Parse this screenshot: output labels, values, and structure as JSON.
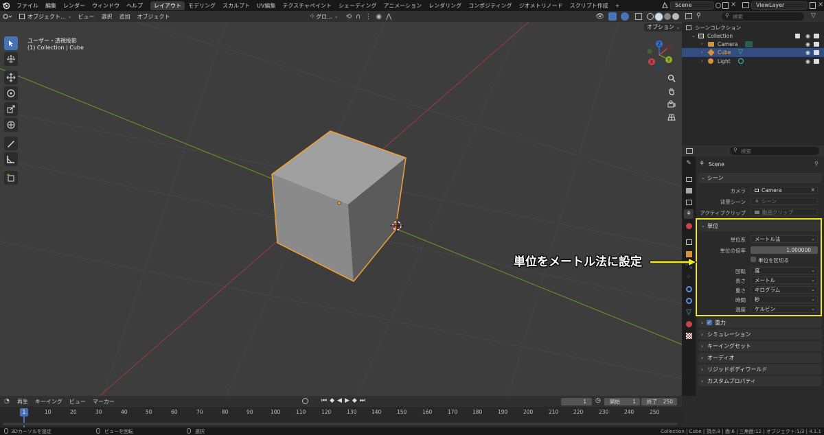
{
  "topbar": {
    "menus": [
      "ファイル",
      "編集",
      "レンダー",
      "ウィンドウ",
      "ヘルプ"
    ],
    "workspaces": [
      "レイアウト",
      "モデリング",
      "スカルプト",
      "UV編集",
      "テクスチャペイント",
      "シェーディング",
      "アニメーション",
      "レンダリング",
      "コンポジティング",
      "ジオメトリノード",
      "スクリプト作成"
    ],
    "active_workspace": "レイアウト",
    "add_tab": "+",
    "scene_name": "Scene",
    "view_layer": "ViewLayer"
  },
  "viewport_header": {
    "mode": "オブジェクト...",
    "menus": [
      "ビュー",
      "選択",
      "追加",
      "オブジェクト"
    ],
    "orientation": "グロ...",
    "options_label": "オプション"
  },
  "viewport": {
    "view_name": "ユーザー・透視投影",
    "object_info": "(1) Collection | Cube",
    "gizmo_labels": [
      "Z",
      "Y",
      "X"
    ]
  },
  "outliner": {
    "search_placeholder": "検索",
    "root": "シーンコレクション",
    "collection": "Collection",
    "items": [
      "Camera",
      "Cube",
      "Light"
    ],
    "selected": "Cube"
  },
  "properties": {
    "search_placeholder": "検索",
    "breadcrumb": "Scene",
    "scene_panel": {
      "title": "シーン",
      "camera_label": "カメラ",
      "camera_value": "Camera",
      "background_label": "背景シーン",
      "background_placeholder": "シーン",
      "clip_label": "アクティブクリップ",
      "clip_placeholder": "動画クリップ"
    },
    "units_panel": {
      "title": "単位",
      "system_label": "単位系",
      "system_value": "メートル法",
      "scale_label": "単位の倍率",
      "scale_value": "1.000000",
      "separate_label": "単位を区切る",
      "rotation_label": "回転",
      "rotation_value": "度",
      "length_label": "長さ",
      "length_value": "メートル",
      "mass_label": "重さ",
      "mass_value": "キログラム",
      "time_label": "時間",
      "time_value": "秒",
      "temperature_label": "温度",
      "temperature_value": "ケルビン"
    },
    "collapsed_panels": [
      "重力",
      "シミュレーション",
      "キーイングセット",
      "オーディオ",
      "リジッドボディワールド",
      "カスタムプロパティ"
    ],
    "gravity_checked": true
  },
  "annotation": {
    "text": "単位をメートル法に設定",
    "highlight_color": "#f0e61e"
  },
  "timeline": {
    "menus": [
      "再生",
      "キーイング",
      "ビュー",
      "マーカー"
    ],
    "current_frame": "1",
    "start_label": "開始",
    "start_value": "1",
    "end_label": "終了",
    "end_value": "250",
    "ticks": [
      "10",
      "20",
      "30",
      "40",
      "50",
      "60",
      "70",
      "80",
      "90",
      "100",
      "110",
      "120",
      "130",
      "140",
      "150",
      "160",
      "170",
      "180",
      "190",
      "200",
      "210",
      "220",
      "230",
      "240",
      "250"
    ]
  },
  "statusbar": {
    "left_items": [
      "3Dカーソルを設定",
      "ビューを回転",
      "選択"
    ],
    "stats": "Collection | Cube | 頂点:8 | 面:6 | 三角面:12 | オブジェクト:1/3 | 4.1.1"
  },
  "colors": {
    "accent": "#4772b3",
    "selection_outline": "#f5a030",
    "x_axis": "#c8424e",
    "y_axis": "#6c9a23"
  }
}
